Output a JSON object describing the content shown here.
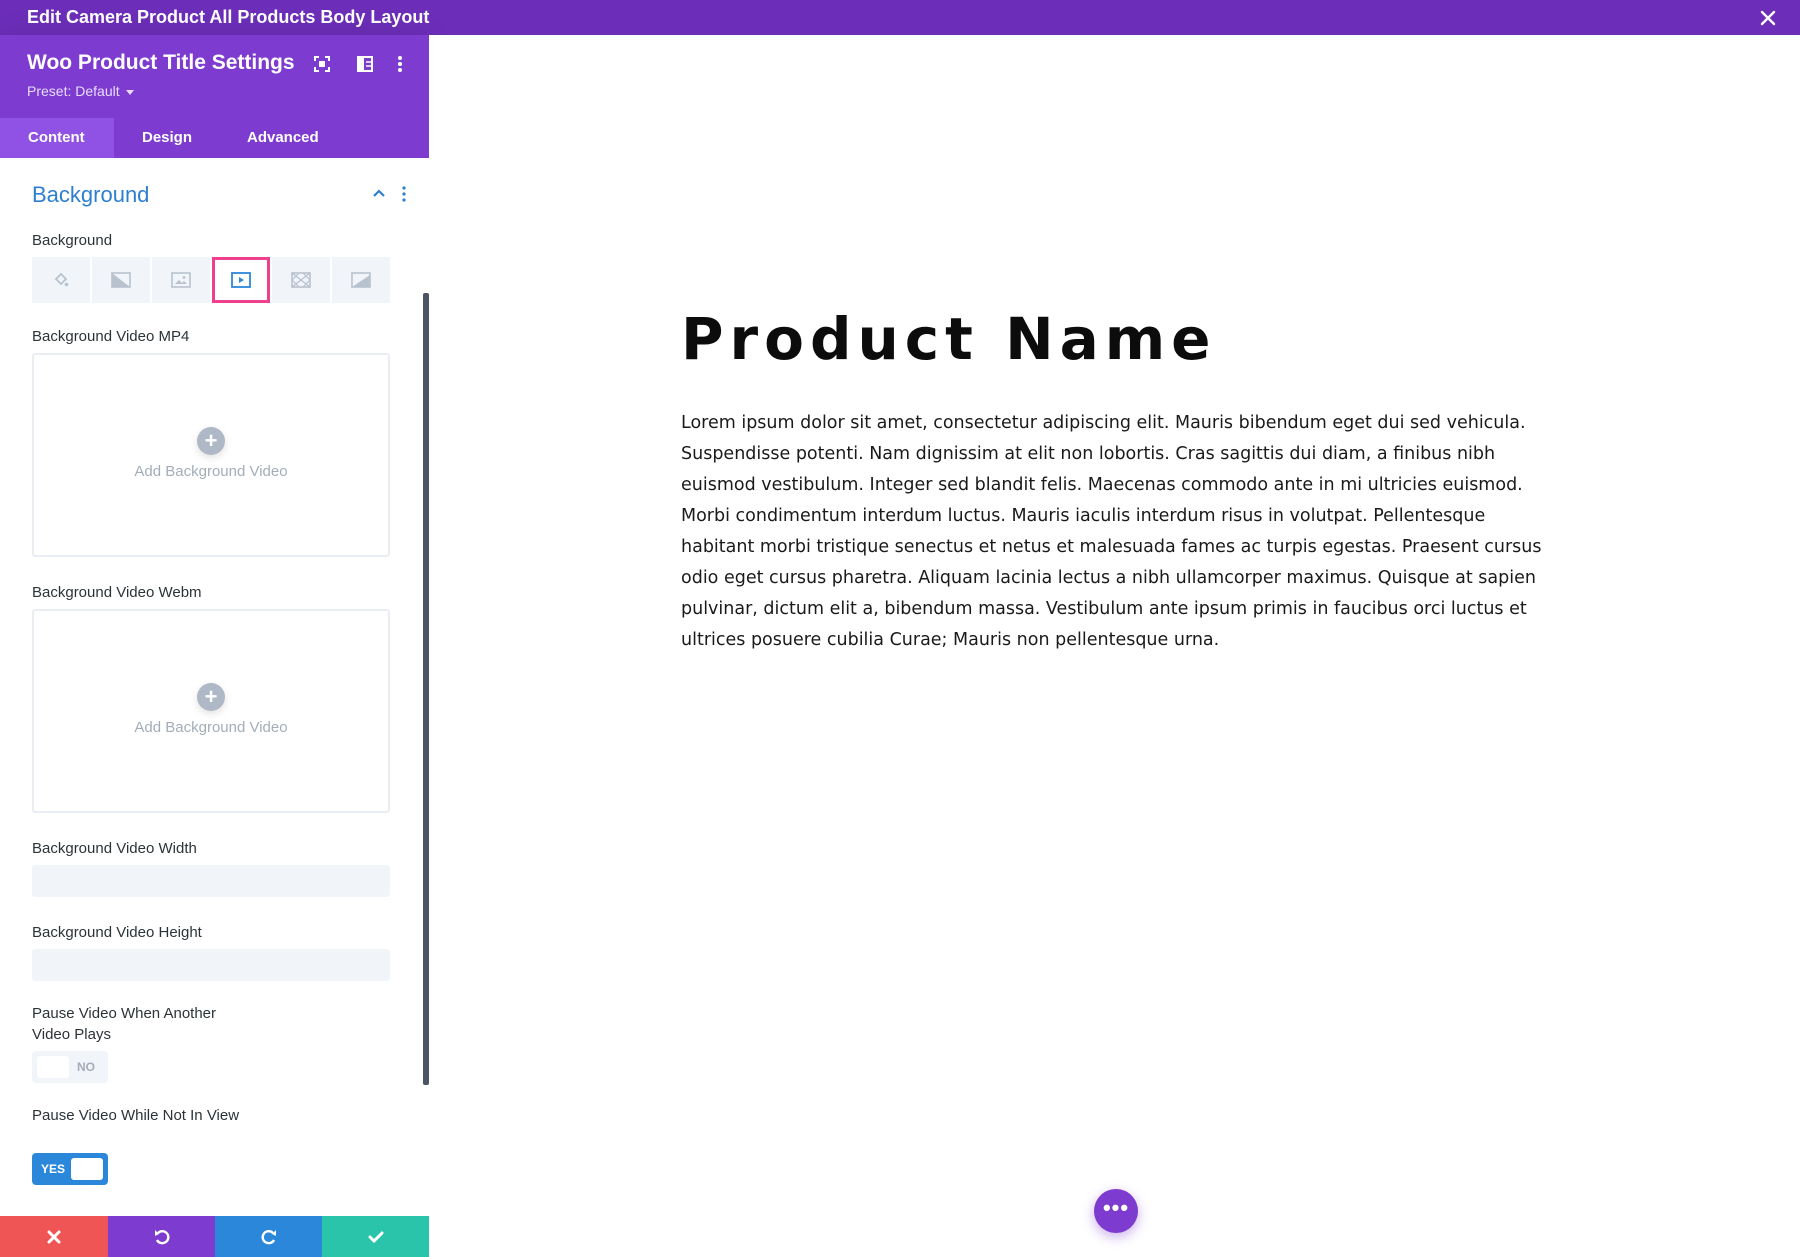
{
  "window": {
    "title": "Edit Camera Product All Products Body Layout"
  },
  "panel": {
    "title": "Woo Product Title Settings",
    "preset": "Preset: Default",
    "tabs": [
      {
        "label": "Content",
        "active": true
      },
      {
        "label": "Design",
        "active": false
      },
      {
        "label": "Advanced",
        "active": false
      }
    ],
    "section": {
      "title": "Background",
      "background_label": "Background",
      "background_types": [
        "color-icon",
        "gradient-icon",
        "image-icon",
        "video-icon",
        "pattern-icon",
        "mask-icon"
      ],
      "active_background_type": "video-icon",
      "mp4_label": "Background Video MP4",
      "mp4_upload_text": "Add Background Video",
      "webm_label": "Background Video Webm",
      "webm_upload_text": "Add Background Video",
      "width_label": "Background Video Width",
      "width_value": "",
      "height_label": "Background Video Height",
      "height_value": "",
      "pause_other_label": "Pause Video When Another Video Plays",
      "pause_other_state": "NO",
      "pause_view_label": "Pause Video While Not In View",
      "pause_view_state": "YES"
    },
    "footer": {
      "buttons": [
        "cancel",
        "undo",
        "redo",
        "save"
      ]
    }
  },
  "canvas": {
    "product_title": "Product Name",
    "product_description": "Lorem ipsum dolor sit amet, consectetur adipiscing elit. Mauris bibendum eget dui sed vehicula. Suspendisse potenti. Nam dignissim at elit non lobortis. Cras sagittis dui diam, a finibus nibh euismod vestibulum. Integer sed blandit felis. Maecenas commodo ante in mi ultricies euismod. Morbi condimentum interdum luctus. Mauris iaculis interdum risus in volutpat. Pellentesque habitant morbi tristique senectus et netus et malesuada fames ac turpis egestas. Praesent cursus odio eget cursus pharetra. Aliquam lacinia lectus a nibh ullamcorper maximus. Quisque at sapien pulvinar, dictum elit a, bibendum massa. Vestibulum ante ipsum primis in faucibus orci luctus et ultrices posuere cubilia Curae; Mauris non pellentesque urna.",
    "fab_label": "•••"
  },
  "colors": {
    "topbar": "#6c2eb9",
    "panel_header": "#7e3bd0",
    "active_tab": "#8f52e5",
    "section_title": "#2e7fcf",
    "highlight": "#ef3f8f",
    "toggle_on": "#2b87da",
    "cancel": "#ef5555",
    "undo": "#7e3bd0",
    "redo": "#2b87da",
    "save": "#29c4a9"
  }
}
